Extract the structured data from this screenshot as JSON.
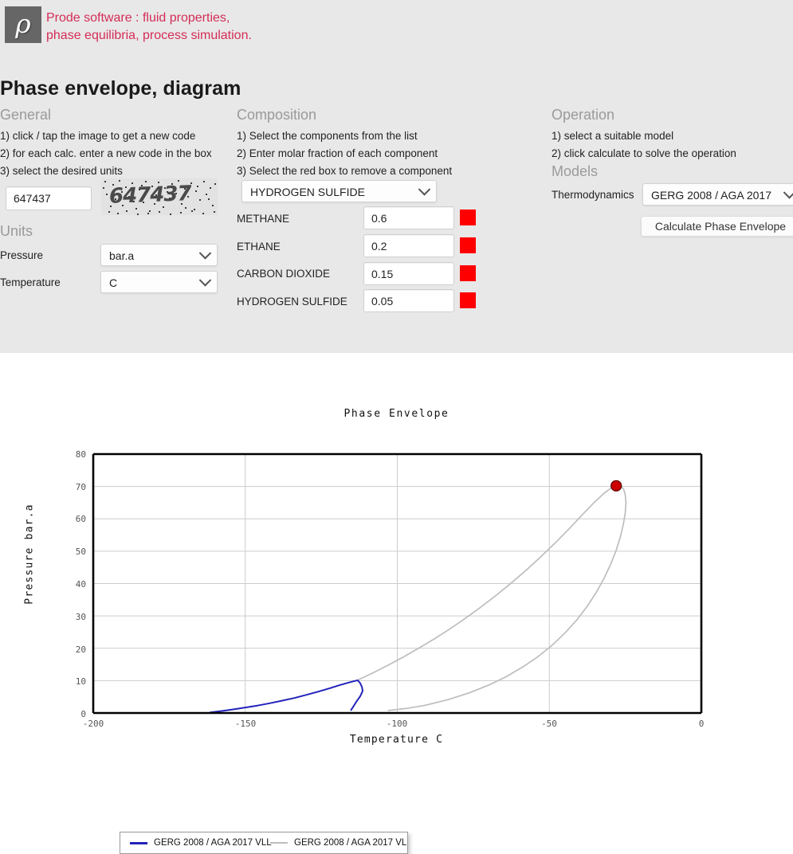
{
  "brand": {
    "logo_glyph": "ρ",
    "tagline_line1": "Prode software : fluid properties,",
    "tagline_line2": "phase equilibria, process simulation.",
    "accent_color": "#d42d56"
  },
  "page_title": "Phase envelope, diagram",
  "general": {
    "heading": "General",
    "steps": [
      "1) click / tap the image to get a new code",
      "2) for each calc. enter a new code in the box",
      "3) select the desired units"
    ],
    "code_value": "647437",
    "captcha_text": "647437"
  },
  "units": {
    "heading": "Units",
    "pressure_label": "Pressure",
    "pressure_value": "bar.a",
    "temperature_label": "Temperature",
    "temperature_value": "C"
  },
  "composition": {
    "heading": "Composition",
    "steps": [
      "1) Select the components from the list",
      "2) Enter molar fraction of each component",
      "3) Select the red box to remove a component"
    ],
    "selector_value": "HYDROGEN SULFIDE",
    "components": [
      {
        "name": "METHANE",
        "fraction": "0.6"
      },
      {
        "name": "ETHANE",
        "fraction": "0.2"
      },
      {
        "name": "CARBON DIOXIDE",
        "fraction": "0.15"
      },
      {
        "name": "HYDROGEN SULFIDE",
        "fraction": "0.05"
      }
    ],
    "remove_color": "#fe0000"
  },
  "operation": {
    "heading": "Operation",
    "steps": [
      "1) select a suitable model",
      "2) click calculate to solve the operation"
    ],
    "models_heading": "Models",
    "thermo_label": "Thermodynamics",
    "thermo_value": "GERG 2008 / AGA 2017",
    "calculate_label": "Calculate Phase Envelope"
  },
  "chart_data": {
    "type": "line",
    "title": "Phase Envelope",
    "xlabel": "Temperature C",
    "ylabel": "Pressure bar.a",
    "xlim": [
      -200,
      0
    ],
    "ylim": [
      0,
      80
    ],
    "xticks": [
      -200,
      -150,
      -100,
      -50,
      0
    ],
    "yticks": [
      0,
      10,
      20,
      30,
      40,
      50,
      60,
      70,
      80
    ],
    "grid": true,
    "legend_position": "top-left",
    "series": [
      {
        "name": "GERG 2008 / AGA 2017 VLL",
        "color": "#2222bb",
        "points": [
          [
            -161.5,
            0.2
          ],
          [
            -158,
            0.6
          ],
          [
            -154,
            1.1
          ],
          [
            -150,
            1.7
          ],
          [
            -146,
            2.3
          ],
          [
            -142,
            3.0
          ],
          [
            -138,
            3.8
          ],
          [
            -134,
            4.6
          ],
          [
            -130,
            5.6
          ],
          [
            -126,
            6.6
          ],
          [
            -122,
            7.7
          ],
          [
            -119,
            8.6
          ],
          [
            -116,
            9.4
          ],
          [
            -114,
            9.9
          ],
          [
            -113,
            10.1
          ],
          [
            -112.2,
            9.2
          ],
          [
            -111.6,
            8.0
          ],
          [
            -111.4,
            6.8
          ],
          [
            -112.2,
            5.2
          ],
          [
            -113.4,
            3.6
          ],
          [
            -114.4,
            2.1
          ],
          [
            -115.2,
            0.9
          ]
        ]
      },
      {
        "name": "GERG 2008 / AGA 2017 VL",
        "color": "#bdbdbd",
        "points": [
          [
            -113,
            10.2
          ],
          [
            -108,
            12.4
          ],
          [
            -103,
            14.8
          ],
          [
            -98,
            17.3
          ],
          [
            -93,
            20.0
          ],
          [
            -88,
            22.8
          ],
          [
            -83,
            25.8
          ],
          [
            -78,
            29.0
          ],
          [
            -73,
            32.4
          ],
          [
            -68,
            36.0
          ],
          [
            -63,
            39.8
          ],
          [
            -58,
            43.8
          ],
          [
            -53,
            48.1
          ],
          [
            -48,
            52.6
          ],
          [
            -43,
            57.4
          ],
          [
            -39,
            61.4
          ],
          [
            -35,
            65.3
          ],
          [
            -32,
            67.9
          ],
          [
            -30,
            69.3
          ],
          [
            -28.5,
            70.0
          ],
          [
            -27.3,
            70.2
          ],
          [
            -26.3,
            69.9
          ],
          [
            -25.5,
            69.0
          ],
          [
            -25.0,
            67.3
          ],
          [
            -24.8,
            65.0
          ],
          [
            -25.0,
            62.0
          ],
          [
            -25.6,
            58.5
          ],
          [
            -26.6,
            54.5
          ],
          [
            -28.0,
            50.3
          ],
          [
            -29.8,
            46.0
          ],
          [
            -32.0,
            41.6
          ],
          [
            -34.6,
            37.2
          ],
          [
            -37.6,
            32.9
          ],
          [
            -41.0,
            28.7
          ],
          [
            -44.8,
            24.8
          ],
          [
            -49.0,
            21.0
          ],
          [
            -53.6,
            17.5
          ],
          [
            -58.6,
            14.3
          ],
          [
            -64.0,
            11.3
          ],
          [
            -70.0,
            8.6
          ],
          [
            -76.4,
            6.2
          ],
          [
            -83.4,
            4.1
          ],
          [
            -90.8,
            2.4
          ],
          [
            -97.0,
            1.4
          ],
          [
            -103.0,
            0.8
          ]
        ]
      }
    ],
    "critical_point": {
      "temperature": -28.0,
      "pressure": 70.2,
      "color": "#cc0000"
    }
  }
}
